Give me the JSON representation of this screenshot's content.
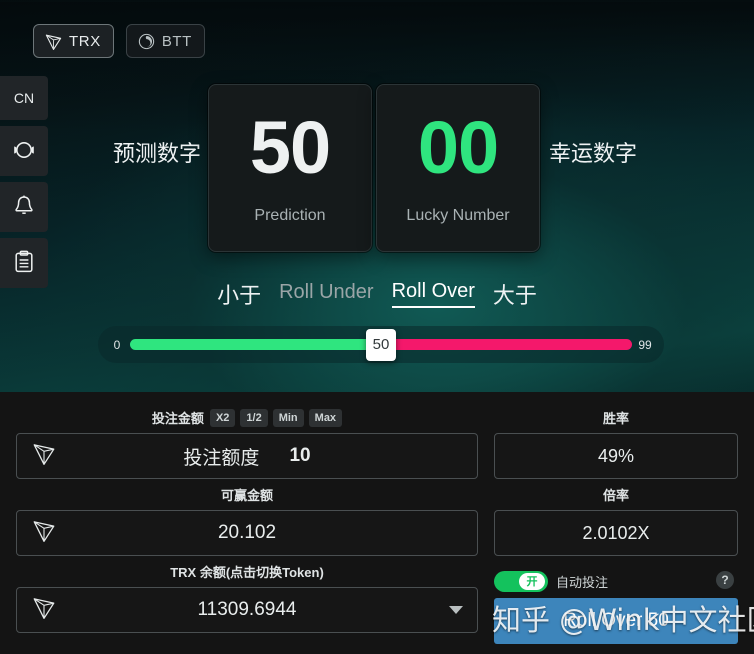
{
  "tokens": [
    {
      "label": "TRX",
      "icon": "tron-icon",
      "active": true
    },
    {
      "label": "BTT",
      "icon": "bittorrent-icon",
      "active": false
    }
  ],
  "rail": [
    {
      "label": "CN",
      "name": "language-switch"
    },
    {
      "label": "",
      "name": "support-headset-icon"
    },
    {
      "label": "",
      "name": "notification-bell-icon"
    },
    {
      "label": "",
      "name": "records-clipboard-icon"
    }
  ],
  "game": {
    "left_label": "预测数字",
    "right_label": "幸运数字",
    "prediction": {
      "value": "50",
      "caption": "Prediction"
    },
    "lucky": {
      "value": "00",
      "caption": "Lucky Number"
    },
    "roll_under": {
      "cn": "小于",
      "en": "Roll Under"
    },
    "roll_over": {
      "cn": "大于",
      "en": "Roll Over"
    },
    "slider": {
      "min": "0",
      "max": "99",
      "value": "50",
      "percent": 50
    }
  },
  "bet": {
    "amount_label": "投注金额",
    "chips": [
      "X2",
      "1/2",
      "Min",
      "Max"
    ],
    "amount_placeholder": "投注额度",
    "amount_value": "10",
    "payout_label": "可赢金额",
    "payout_value": "20.102",
    "balance_label": "TRX 余额(点击切换Token)",
    "balance_value": "11309.6944"
  },
  "stats": {
    "winrate_label": "胜率",
    "winrate_value": "49%",
    "multiplier_label": "倍率",
    "multiplier_value": "2.0102X"
  },
  "actions": {
    "auto_toggle_state": "开",
    "auto_label": "自动投注",
    "help": "?",
    "roll_button": "Roll Over 50"
  },
  "watermark": "知乎 @Wink中文社区",
  "colors": {
    "green": "#2fe57f",
    "pink": "#f4186b",
    "toggle_on": "#14c25d",
    "button_blue": "#3d85bb"
  }
}
